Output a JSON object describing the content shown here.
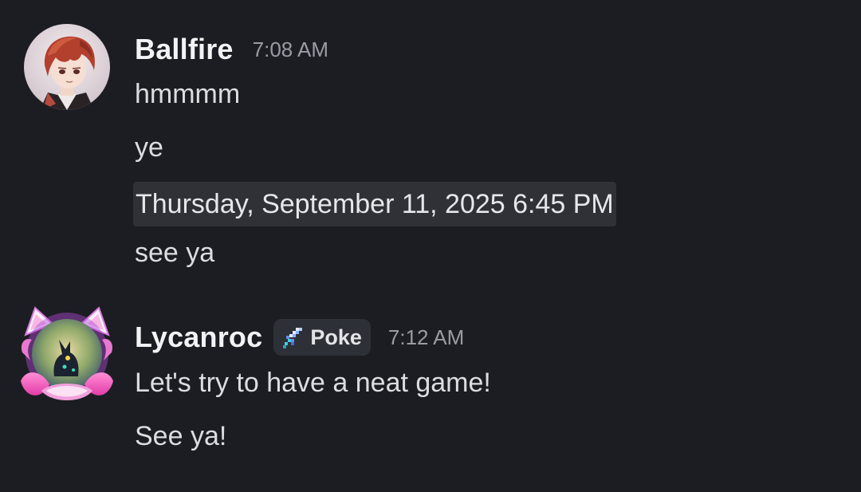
{
  "messages": [
    {
      "username": "Ballfire",
      "time": "7:08 AM",
      "lines": [
        "hmmmm",
        "ye",
        "Thursday, September 11, 2025 6:45 PM",
        "see ya"
      ]
    },
    {
      "username": "Lycanroc",
      "tag": {
        "label": "Poke",
        "icon": "sword-icon"
      },
      "time": "7:12 AM",
      "lines": [
        "Let's try to have a neat game!",
        "See ya!"
      ]
    }
  ],
  "colors": {
    "background": "#1c1d22",
    "date_highlight": "#2f3137",
    "tag_background": "#2e3037"
  }
}
